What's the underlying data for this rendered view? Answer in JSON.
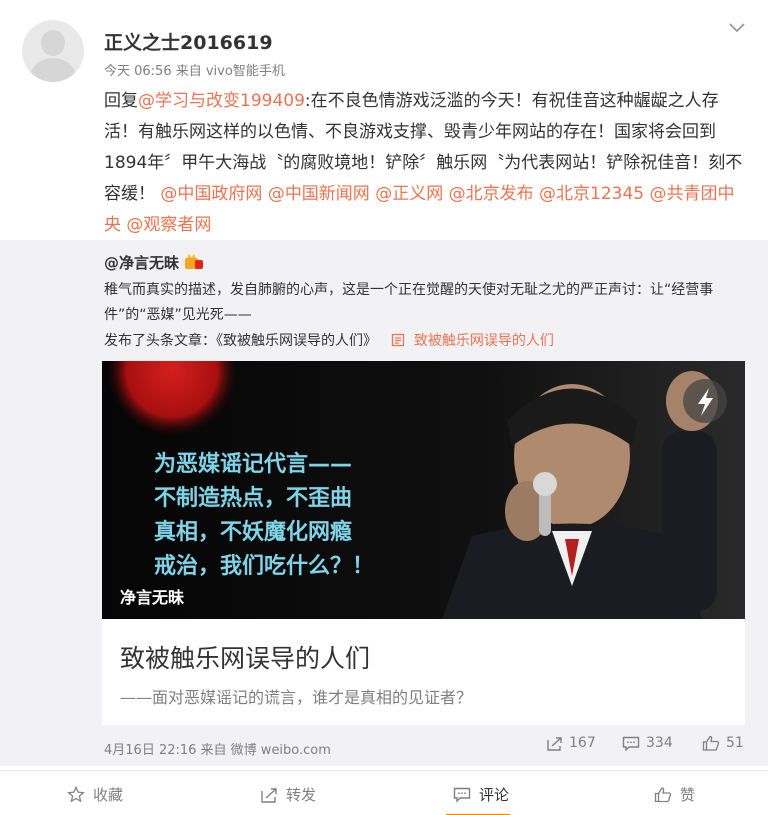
{
  "author": {
    "name": "正义之士2016619",
    "meta": "今天 06:56 来自 vivo智能手机"
  },
  "post": {
    "reply_prefix": "回复",
    "reply_to": "@学习与改变199409",
    "body": ":在不良色情游戏泛滥的今天！有祝佳音这种龌龊之人存活！有触乐网这样的以色情、不良游戏支撑、毁青少年网站的存在！国家将会回到1894年〞甲午大海战〝的腐败境地！铲除〞触乐网〝为代表网站！铲除祝佳音！刻不容缓！",
    "mentions": [
      "@中国政府网",
      "@中国新闻网",
      "@正义网",
      "@北京发布",
      "@北京12345",
      "@共青团中央",
      "@观察者网"
    ]
  },
  "repost": {
    "author": "@净言无昧",
    "text": "稚气而真实的描述，发自肺腑的心声，这是一个正在觉醒的天使对无耻之尤的严正声讨：让“经营事件”的“恶媒”见光死——",
    "article_prefix": "发布了头条文章：《致被触乐网误导的人们》",
    "article_link": "致被触乐网误导的人们",
    "card": {
      "overlay_lines": [
        "为恶媒谣记代言——",
        "不制造热点，不歪曲",
        "真相，不妖魔化网瘾",
        "戒治，我们吃什么？！"
      ],
      "watermark": "净言无昧",
      "title": "致被触乐网误导的人们",
      "subtitle": "——面对恶媒谣记的谎言，谁才是真相的见证者？"
    },
    "date": "4月16日 22:16 来自 微博 weibo.com",
    "reposts": "167",
    "comments": "334",
    "likes": "51"
  },
  "actions": {
    "collect": "收藏",
    "forward": "转发",
    "comment": "评论",
    "like": "赞"
  },
  "colors": {
    "link": "#eb7350",
    "secondary_text": "#808080",
    "repost_bg": "#f2f2f5",
    "active_tab": "#ff8200"
  }
}
